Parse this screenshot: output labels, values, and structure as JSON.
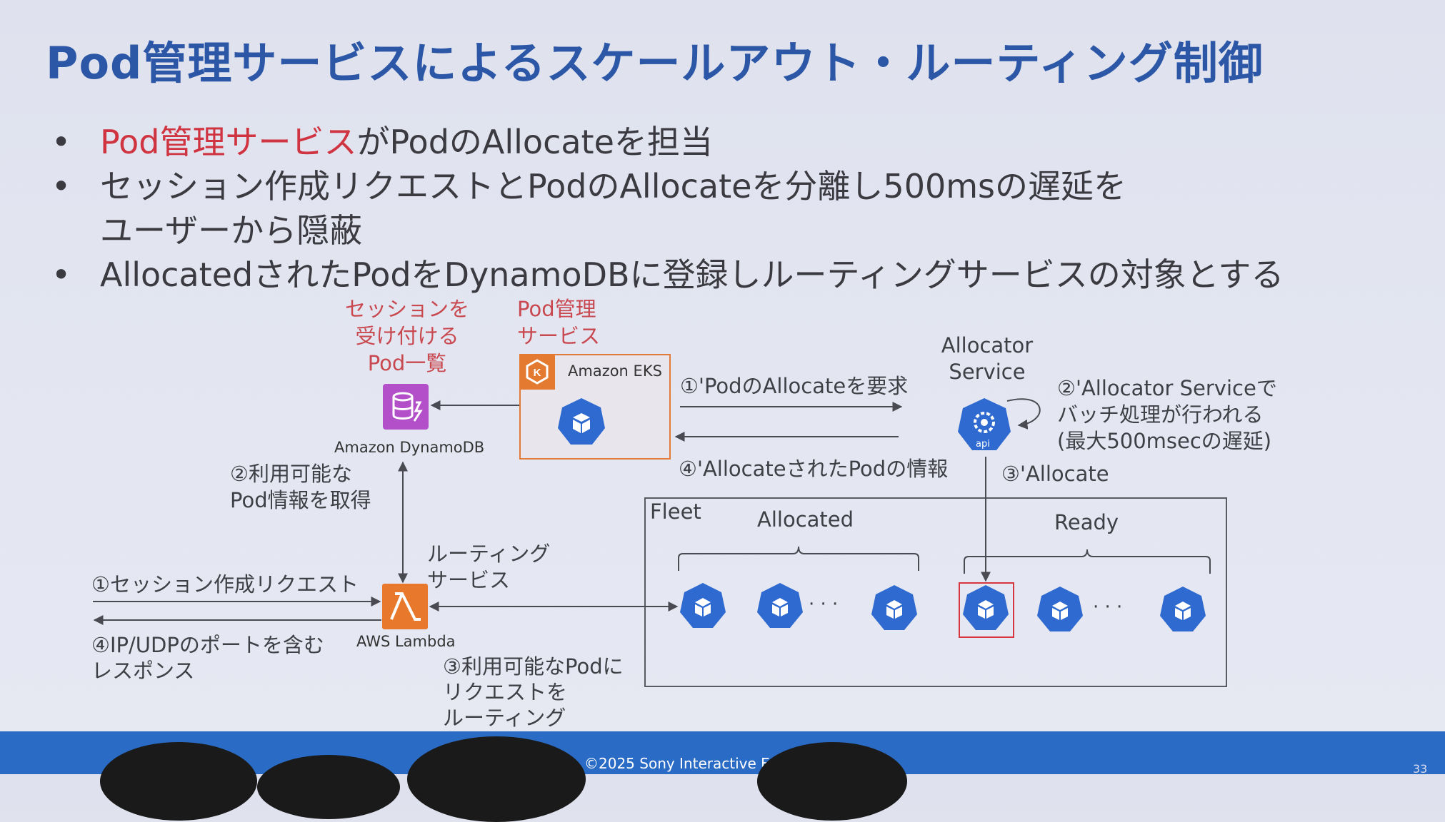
{
  "title": "Pod管理サービスによるスケールアウト・ルーティング制御",
  "bullets": {
    "marker": "•",
    "b1_red": "Pod管理サービス",
    "b1_rest": "がPodのAllocateを担当",
    "b2_line1": "セッション作成リクエストとPodのAllocateを分離し500msの遅延を",
    "b2_line2": "ユーザーから隠蔽",
    "b3": "AllocatedされたPodをDynamoDBに登録しルーティングサービスの対象とする"
  },
  "diagram": {
    "session_pod_list": [
      "セッションを",
      "受け付ける",
      "Pod一覧"
    ],
    "pod_mgmt": [
      "Pod管理",
      "サービス"
    ],
    "amazon_eks": "Amazon EKS",
    "amazon_dynamodb": "Amazon DynamoDB",
    "aws_lambda": "AWS Lambda",
    "allocator_service": [
      "Allocator",
      "Service"
    ],
    "api_label": "api",
    "step1p": "①'PodのAllocateを要求",
    "step4p": "④'AllocateされたPodの情報",
    "step2p": [
      "②'Allocator Serviceで",
      "バッチ処理が行われる",
      "(最大500msecの遅延)"
    ],
    "step3p": "③'Allocate",
    "step2": [
      "②利用可能な",
      "Pod情報を取得"
    ],
    "routing_service": [
      "ルーティング",
      "サービス"
    ],
    "step1": "①セッション作成リクエスト",
    "step4": [
      "④IP/UDPのポートを含む",
      "レスポンス"
    ],
    "step3": [
      "③利用可能なPodに",
      "リクエストを",
      "ルーティング"
    ],
    "fleet": "Fleet",
    "allocated": "Allocated",
    "ready": "Ready",
    "ellipsis": "· · ·"
  },
  "footer": {
    "copyright": "©2025 Sony Interactive Ent",
    "page": "33"
  },
  "colors": {
    "title": "#2c57a6",
    "accent_red": "#cf3440",
    "pod_blue": "#2f6ad0",
    "eks_orange": "#e37a2f",
    "dynamodb_purple": "#b34fc9",
    "footer_blue": "#2a6bc6"
  },
  "icons": [
    "kubernetes-pod-icon",
    "dynamodb-icon",
    "lambda-icon",
    "eks-icon",
    "kubernetes-api-icon"
  ]
}
